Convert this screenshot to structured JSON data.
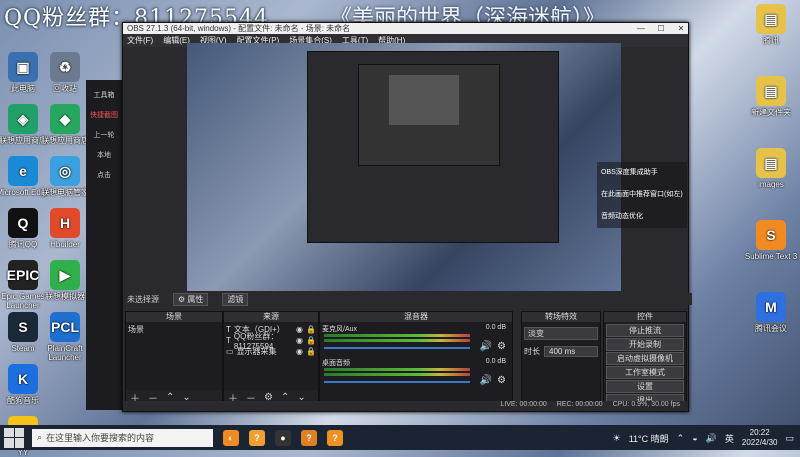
{
  "banner": {
    "qq": "QQ粉丝群：811275544",
    "song": "《美丽的世界（深海迷航）》"
  },
  "desktop_icons": [
    {
      "label": "此电脑",
      "color": "#3a6fb0",
      "glyph": "▣"
    },
    {
      "label": "联想应用商店",
      "color": "#22a06a",
      "glyph": "◈"
    },
    {
      "label": "Microsoft Edge",
      "color": "#1a8ad6",
      "glyph": "e"
    },
    {
      "label": "腾讯QQ",
      "color": "#111111",
      "glyph": "Q"
    },
    {
      "label": "Epic Games Launcher",
      "color": "#222222",
      "glyph": "EPIC"
    },
    {
      "label": "Steam",
      "color": "#1b2838",
      "glyph": "S"
    },
    {
      "label": "酷狗音乐",
      "color": "#1d6fe0",
      "glyph": "K"
    },
    {
      "label": "YY",
      "color": "#f5c21a",
      "glyph": "YY"
    },
    {
      "label": "回收站",
      "color": "#6b7a8f",
      "glyph": "♻"
    },
    {
      "label": "联想应用商店",
      "color": "#27a65f",
      "glyph": "◆"
    },
    {
      "label": "联想电脑管家",
      "color": "#3aa0e0",
      "glyph": "◎"
    },
    {
      "label": "Hbuilder",
      "color": "#e04a2a",
      "glyph": "H"
    },
    {
      "label": "联想模拟器",
      "color": "#2fb04a",
      "glyph": "▶"
    },
    {
      "label": "PlainCraft Launcher",
      "color": "#1d6fd0",
      "glyph": "PCL"
    }
  ],
  "right_icons": [
    {
      "label": "腾讯",
      "color": "#e6c24a",
      "glyph": "▤"
    },
    {
      "label": "新建文件夹",
      "color": "#e6c24a",
      "glyph": "▤"
    },
    {
      "label": "images",
      "color": "#e6c24a",
      "glyph": "▤"
    },
    {
      "label": "Sublime Text 3",
      "color": "#f08b22",
      "glyph": "S"
    },
    {
      "label": "腾讯会议",
      "color": "#2f6fe0",
      "glyph": "M"
    }
  ],
  "left_strip": [
    "工具箱",
    "快捷截图",
    "上一轮",
    "本地",
    "点击"
  ],
  "obs": {
    "title": "OBS 27.1.3 (64-bit, windows) - 配置文件: 未命名 - 场景: 未命名",
    "menu": [
      "文件(F)",
      "编辑(E)",
      "视图(V)",
      "配置文件(P)",
      "场景集合(S)",
      "工具(T)",
      "帮助(H)"
    ],
    "status_text": "未选择源",
    "attr_button": "⚙ 属性",
    "filter_button": "滤镜",
    "docks": {
      "scenes": {
        "title": "场景",
        "items": [
          "场景"
        ]
      },
      "sources": {
        "title": "来源",
        "items": [
          {
            "type": "T",
            "name": "文本（GDI+）"
          },
          {
            "type": "T",
            "name": "QQ粉丝群：811275594"
          },
          {
            "type": "▭",
            "name": "显示器采集"
          }
        ]
      },
      "mixer": {
        "title": "混音器",
        "rows": [
          {
            "name": "麦克风/Aux",
            "db": "0.0 dB"
          },
          {
            "name": "桌面音频",
            "db": "0.0 dB"
          }
        ]
      },
      "transition": {
        "title": "转场特效",
        "type": "淡变",
        "duration_label": "时长",
        "duration": "400 ms"
      },
      "controls": {
        "title": "控件",
        "buttons": [
          "停止推流",
          "开始录制",
          "启动虚拟摄像机",
          "工作室模式",
          "设置",
          "退出"
        ]
      }
    },
    "bottom": {
      "live": "LIVE: 00:00:00",
      "rec": "REC: 00:00:00",
      "cpu": "CPU: 0.9%, 30.00 fps"
    }
  },
  "context_menu": [
    "OBS深度集成助手",
    "在此画面中推荐窗口(如左)",
    "音频动态优化"
  ],
  "taskbar": {
    "search_placeholder": "在这里输入你要搜索的内容",
    "apps": [
      {
        "color": "#f08a22",
        "glyph": "◐"
      },
      {
        "color": "#f0a030",
        "glyph": "?"
      },
      {
        "color": "#333333",
        "glyph": "●"
      },
      {
        "color": "#e08020",
        "glyph": "?"
      },
      {
        "color": "#f09020",
        "glyph": "?"
      }
    ],
    "weather": "11°C 晴朗",
    "input_method": "英",
    "time": "20:22",
    "date": "2022/4/30"
  }
}
